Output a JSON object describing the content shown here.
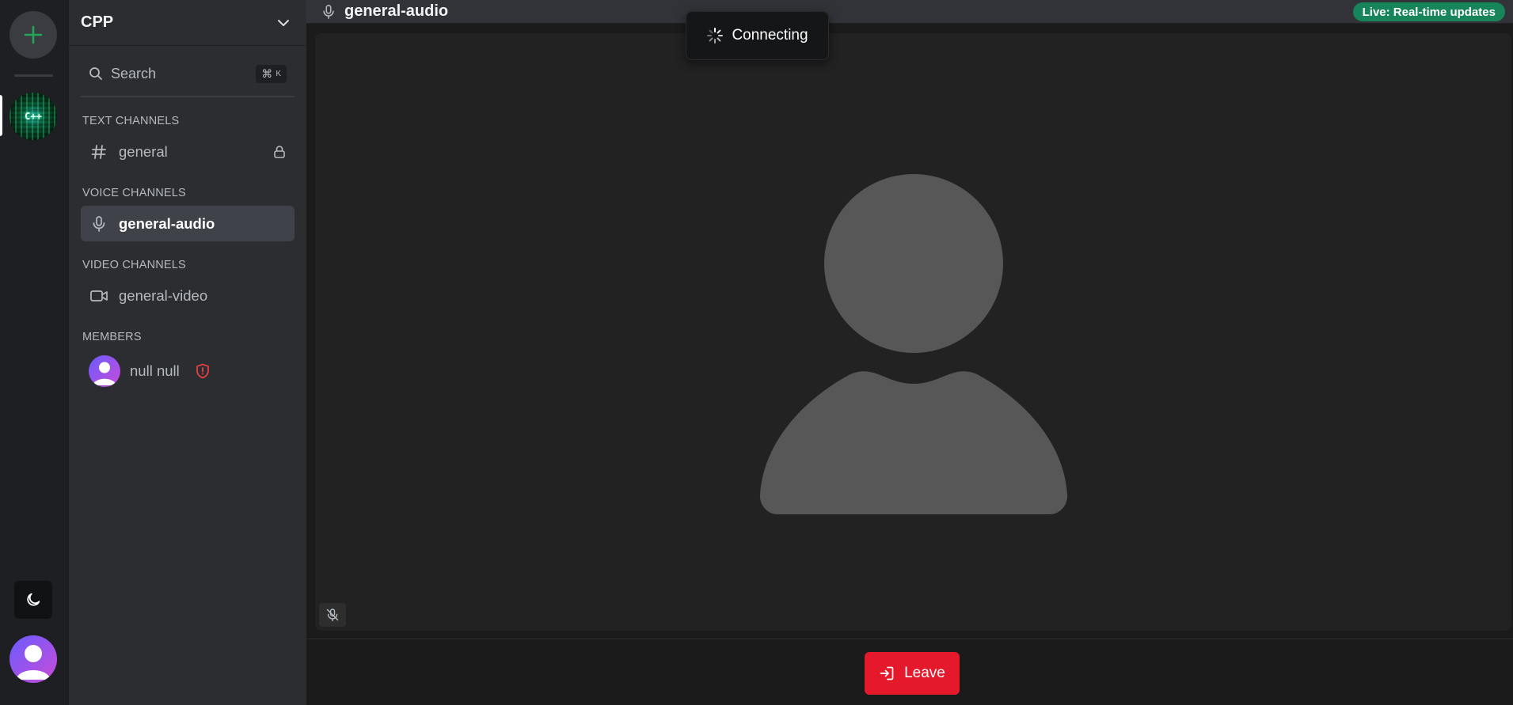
{
  "rail": {
    "add_server_icon": "plus-icon",
    "server_label": "C++",
    "theme_icon": "moon-icon",
    "user_icon": "user-avatar-icon"
  },
  "sidebar": {
    "server_name": "CPP",
    "search": {
      "label": "Search",
      "shortcut_symbol": "⌘",
      "shortcut_key": "K"
    },
    "sections": {
      "text": "TEXT CHANNELS",
      "voice": "VOICE CHANNELS",
      "video": "VIDEO CHANNELS",
      "members": "MEMBERS"
    },
    "channels": {
      "text": [
        {
          "name": "general",
          "icon": "hash-icon",
          "locked": true
        }
      ],
      "voice": [
        {
          "name": "general-audio",
          "icon": "mic-icon",
          "active": true
        }
      ],
      "video": [
        {
          "name": "general-video",
          "icon": "video-icon"
        }
      ]
    },
    "members": [
      {
        "name": "null null",
        "role_icon": "shield-alert-icon"
      }
    ]
  },
  "header": {
    "channel_name": "general-audio",
    "live_badge": "Live: Real-time updates"
  },
  "main": {
    "status": "Connecting",
    "leave_label": "Leave"
  },
  "colors": {
    "accent_green": "#23a55a",
    "live_badge": "#18845a",
    "leave_button": "#e4192c",
    "admin_badge": "#f23f43",
    "active_channel_bg": "#404249"
  }
}
